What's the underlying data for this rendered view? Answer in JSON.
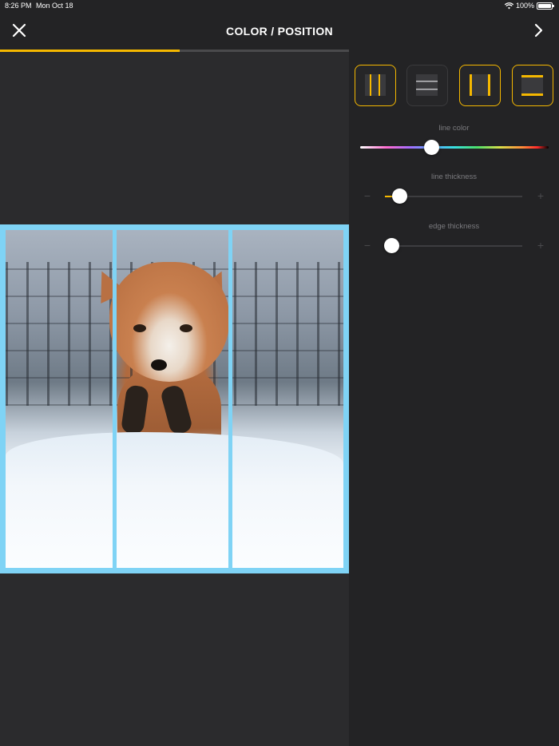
{
  "status": {
    "time": "8:26 PM",
    "date": "Mon Oct 18",
    "battery": "100%",
    "battery_level": 100
  },
  "nav": {
    "title": "COLOR / POSITION",
    "close_icon": "close-icon",
    "next_icon": "chevron-right-icon"
  },
  "progress": {
    "fraction": 0.515,
    "color": "#f5b800"
  },
  "frame": {
    "color": "#7fd3f5",
    "layout": "three vertical panels"
  },
  "modes": [
    {
      "name": "vertical-lines",
      "active": true
    },
    {
      "name": "horizontal-lines",
      "active": false
    },
    {
      "name": "vertical-edges",
      "active": true
    },
    {
      "name": "horizontal-edges",
      "active": true
    }
  ],
  "sliders": {
    "line_color": {
      "label": "line color",
      "fraction": 0.38
    },
    "line_thickness": {
      "label": "line thickness",
      "fraction": 0.11,
      "minus": "−",
      "plus": "+"
    },
    "edge_thickness": {
      "label": "edge thickness",
      "fraction": 0.05,
      "minus": "−",
      "plus": "+"
    }
  },
  "colors": {
    "accent": "#f5b800",
    "background": "#232325",
    "frame": "#7fd3f5"
  }
}
